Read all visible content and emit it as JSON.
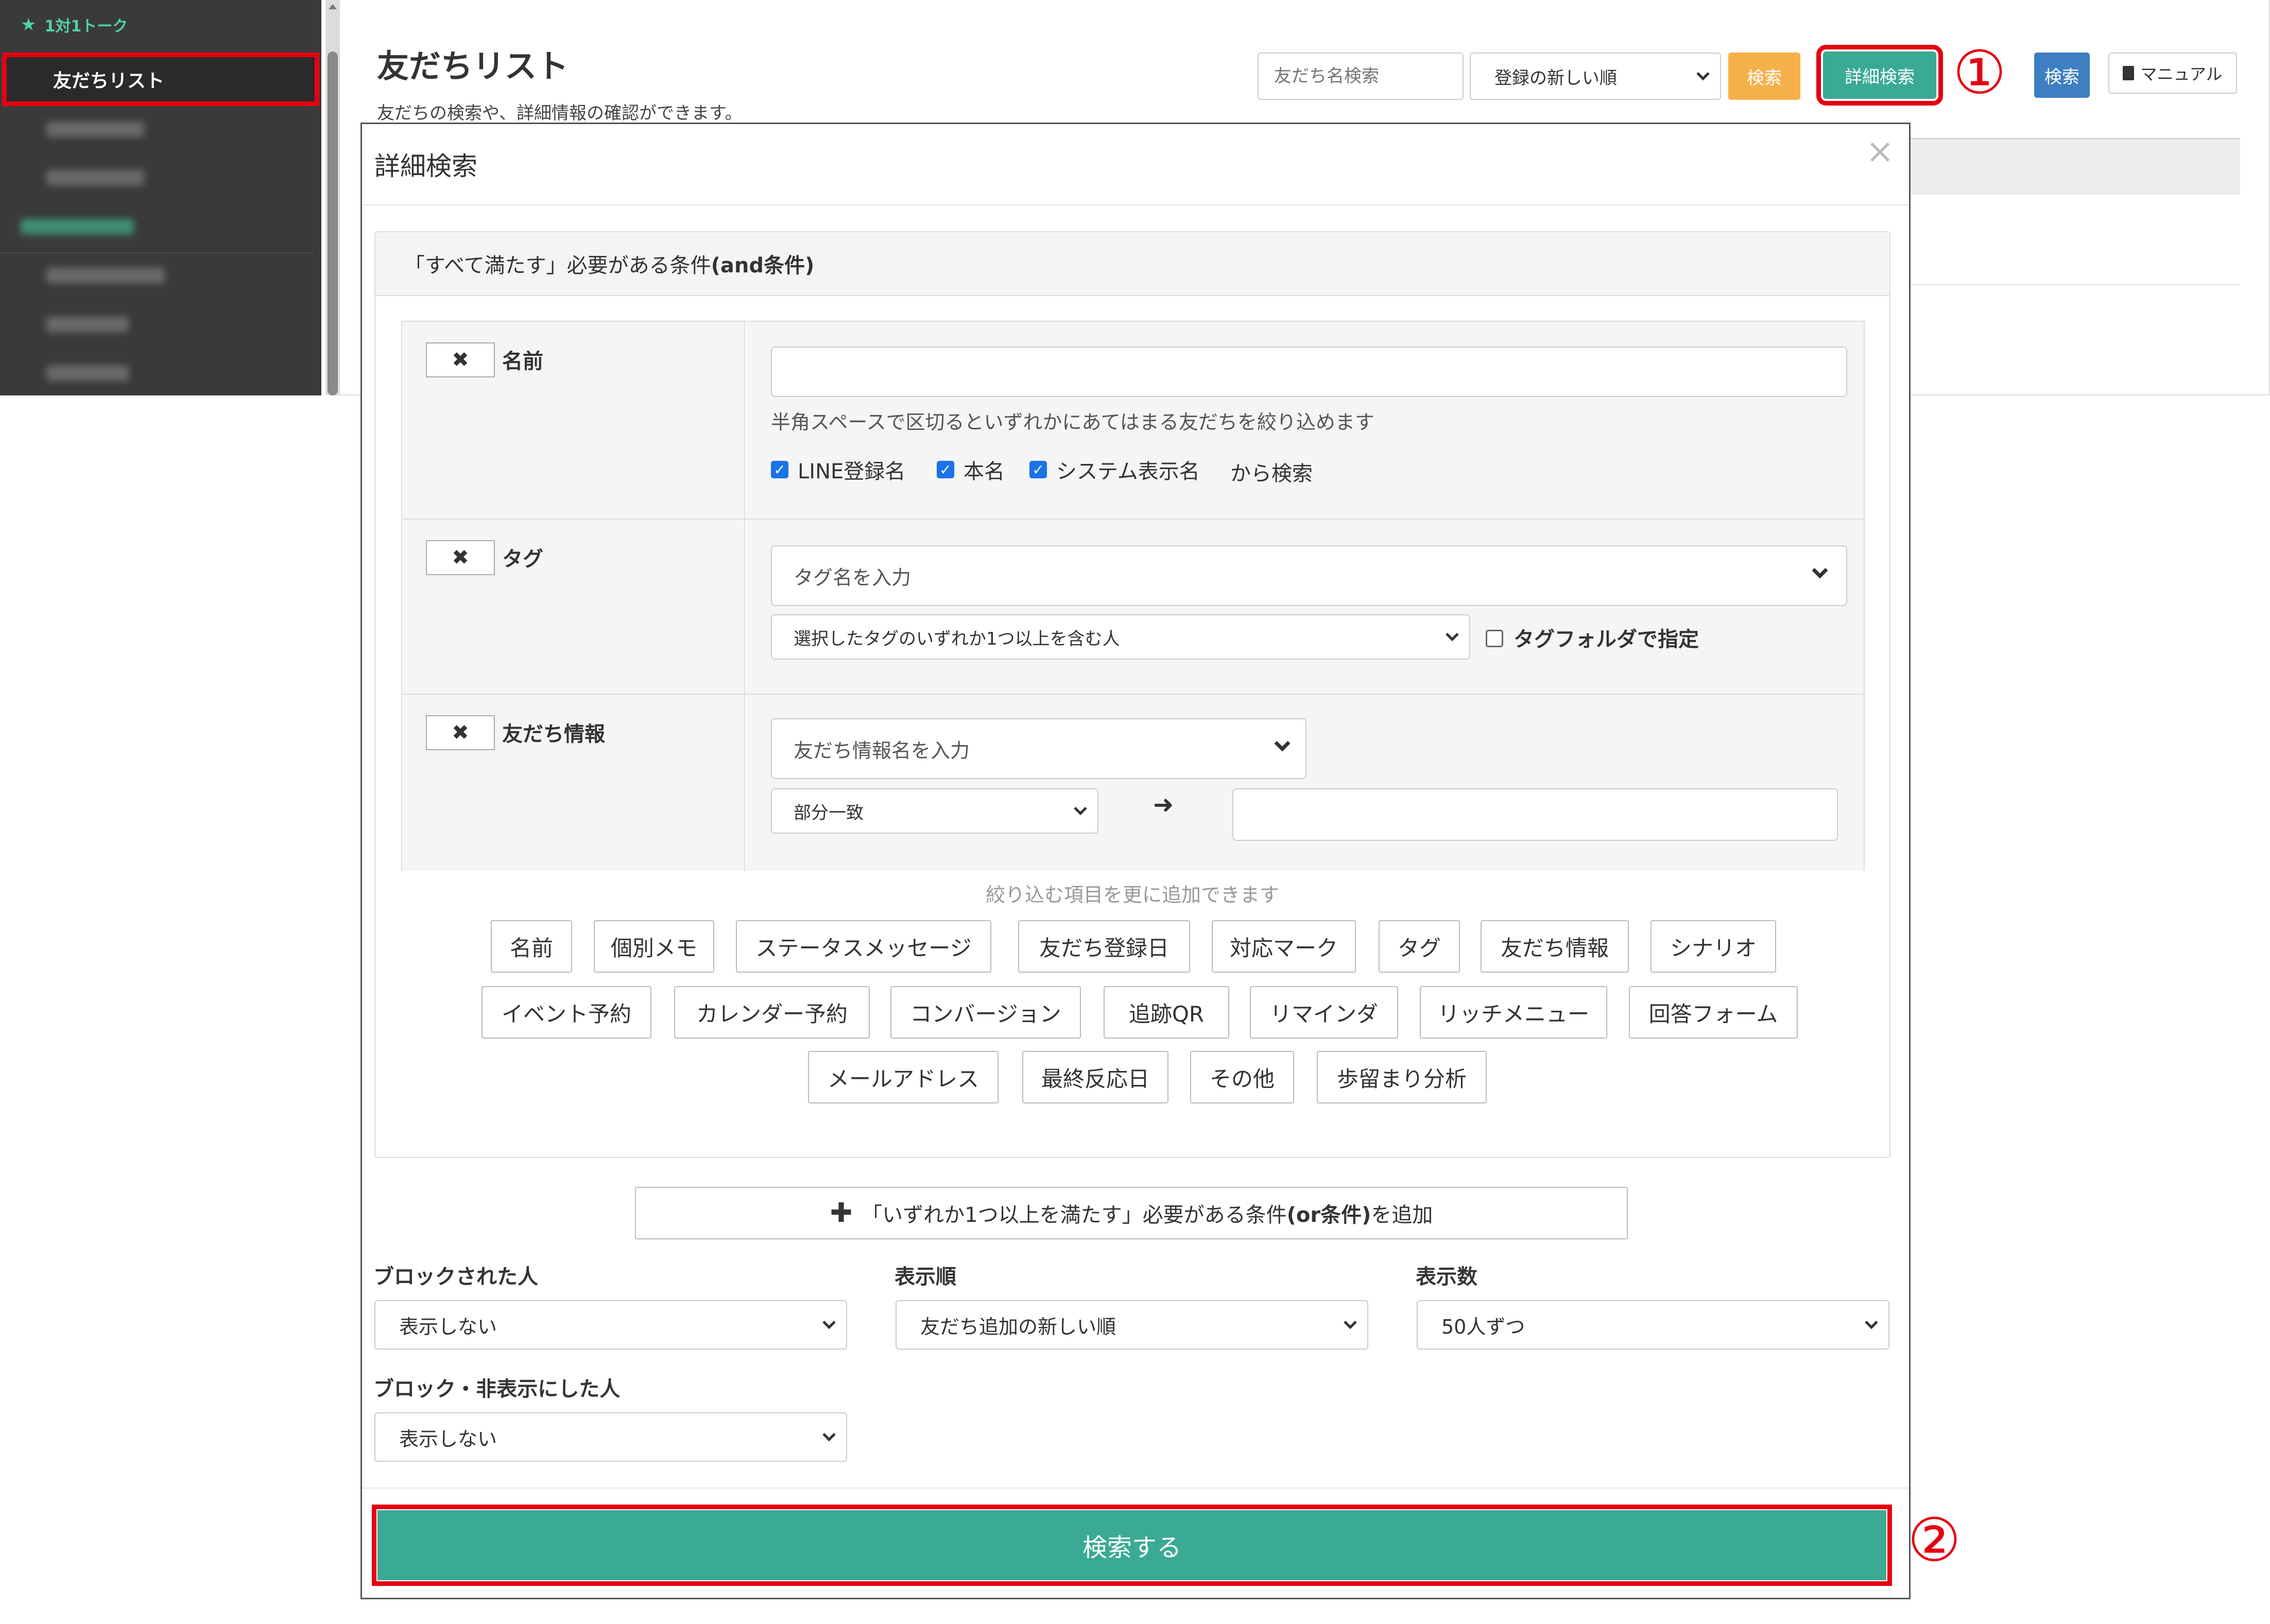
{
  "sidebar": {
    "section_label": "1対1トーク",
    "active_item": "友だちリスト"
  },
  "header": {
    "title": "友だちリスト",
    "subtitle": "友だちの検索や、詳細情報の確認ができます。",
    "search_placeholder": "友だち名検索",
    "sort_value": "登録の新しい順",
    "search_button": "検索",
    "detail_button": "詳細検索",
    "search_button_blue": "検索",
    "manual_button": "マニュアル"
  },
  "annotations": {
    "step1": "①",
    "step2": "②"
  },
  "modal": {
    "title": "詳細検索",
    "close": "×",
    "and_panel_title_prefix": "「すべて満たす」必要がある条件 ",
    "and_panel_title_bold": "(and条件)",
    "remove_mark": "✖",
    "conditions": {
      "name": {
        "label": "名前",
        "hint": "半角スペースで区切るといずれかにあてはまる友だちを絞り込めます",
        "checks": [
          "LINE登録名",
          "本名",
          "システム表示名"
        ],
        "suffix": "から検索"
      },
      "tag": {
        "label": "タグ",
        "placeholder": "タグ名を入力",
        "mode": "選択したタグのいずれか1つ以上を含む人",
        "folder_label": "タグフォルダで指定"
      },
      "info": {
        "label": "友だち情報",
        "placeholder": "友だち情報名を入力",
        "match": "部分一致"
      }
    },
    "more_hint": "絞り込む項目を更に追加できます",
    "chips_row1": [
      "名前",
      "個別メモ",
      "ステータスメッセージ",
      "友だち登録日",
      "対応マーク",
      "タグ",
      "友だち情報",
      "シナリオ"
    ],
    "chips_row2": [
      "イベント予約",
      "カレンダー予約",
      "コンバージョン",
      "追跡QR",
      "リマインダ",
      "リッチメニュー",
      "回答フォーム"
    ],
    "chips_row3": [
      "メールアドレス",
      "最終反応日",
      "その他",
      "歩留まり分析"
    ],
    "or_button_prefix": "「いずれか1つ以上を満たす」必要がある条件",
    "or_button_bold": "(or条件)",
    "or_button_suffix": "を追加",
    "options": {
      "blocked_label": "ブロックされた人",
      "blocked_value": "表示しない",
      "order_label": "表示順",
      "order_value": "友だち追加の新しい順",
      "count_label": "表示数",
      "count_value": "50人ずつ",
      "hidden_label": "ブロック・非表示にした人",
      "hidden_value": "表示しない"
    },
    "submit": "検索する"
  },
  "colors": {
    "accent": "#3aaa94",
    "highlight": "#e60012",
    "orange": "#f6b04a",
    "blue": "#3d7fc2"
  }
}
